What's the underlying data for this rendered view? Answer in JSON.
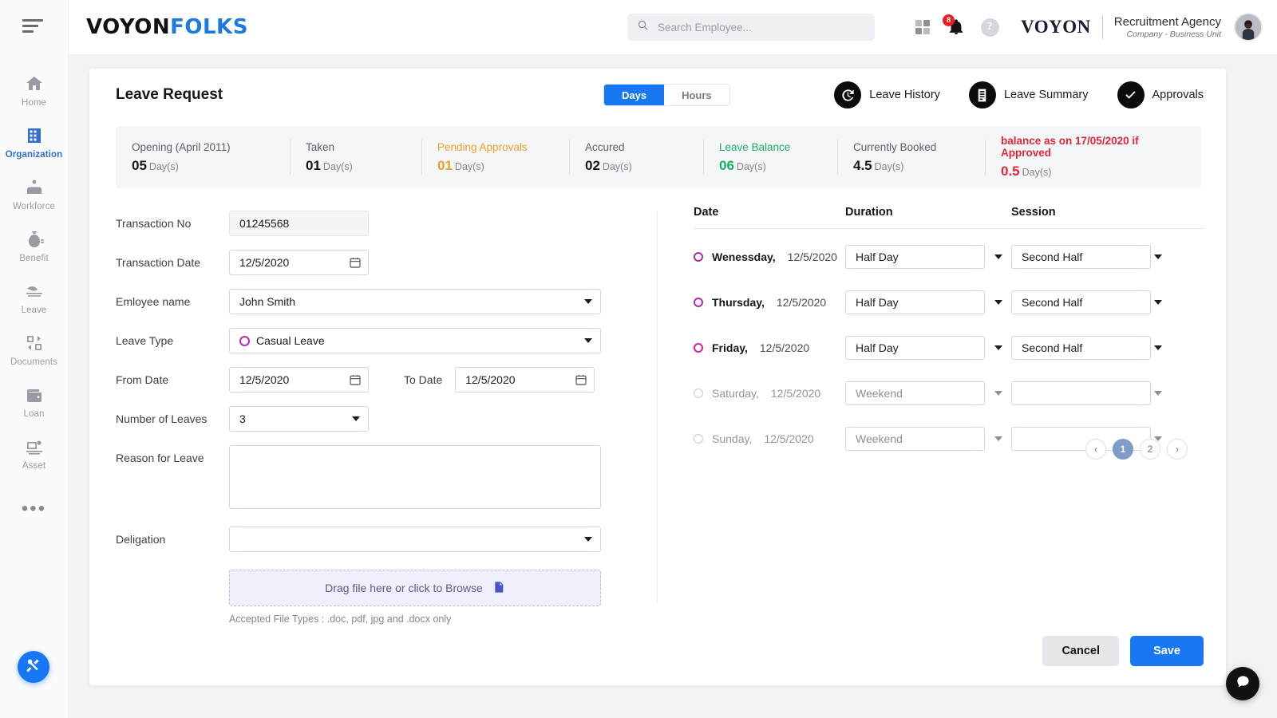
{
  "sidebar": {
    "menu_icon": "hamburger-icon",
    "items": [
      {
        "label": "Home",
        "icon": "home-icon",
        "active": false
      },
      {
        "label": "Organization",
        "icon": "building-icon",
        "active": true
      },
      {
        "label": "Workforce",
        "icon": "workforce-icon",
        "active": false
      },
      {
        "label": "Benefit",
        "icon": "money-bag-icon",
        "active": false
      },
      {
        "label": "Leave",
        "icon": "leave-icon",
        "active": false
      },
      {
        "label": "Documents",
        "icon": "documents-icon",
        "active": false
      },
      {
        "label": "Loan",
        "icon": "wallet-icon",
        "active": false
      },
      {
        "label": "Asset",
        "icon": "asset-icon",
        "active": false
      }
    ],
    "more_label": "•••",
    "fab_tools_icon": "tools-icon"
  },
  "header": {
    "logo_part1": "VOYON",
    "logo_part2": "FOLKS",
    "search_placeholder": "Search Employee...",
    "search_value": "",
    "notification_count": "8",
    "help_label": "?",
    "brand_mark": "VOYON",
    "company_name": "Recruitment Agency",
    "company_sub": "Company - Business Unit"
  },
  "page": {
    "title": "Leave Request",
    "toggle": {
      "active": "Days",
      "inactive": "Hours"
    },
    "actions": [
      {
        "label": "Leave History",
        "icon": "history-clock-icon"
      },
      {
        "label": "Leave Summary",
        "icon": "list-document-icon"
      },
      {
        "label": "Approvals",
        "icon": "check-icon"
      }
    ]
  },
  "stats": [
    {
      "label": "Opening (April 2011)",
      "value": "05",
      "unit": "Day(s)",
      "color": "#15151a",
      "label_color": "#5d5f68"
    },
    {
      "label": "Taken",
      "value": "01",
      "unit": "Day(s)",
      "color": "#15151a",
      "label_color": "#5d5f68"
    },
    {
      "label": "Pending Approvals",
      "value": "01",
      "unit": "Day(s)",
      "color": "#f0a02a",
      "label_color": "#f0a02a"
    },
    {
      "label": "Accured",
      "value": "02",
      "unit": "Day(s)",
      "color": "#15151a",
      "label_color": "#5d5f68"
    },
    {
      "label": "Leave Balance",
      "value": "06",
      "unit": "Day(s)",
      "color": "#18b05f",
      "label_color": "#18b05f"
    },
    {
      "label": "Currently Booked",
      "value": "4.5",
      "unit": "Day(s)",
      "color": "#15151a",
      "label_color": "#5d5f68"
    },
    {
      "label": "balance as on 17/05/2020 if Approved",
      "value": "0.5",
      "unit": "Day(s)",
      "color": "#e1263a",
      "label_color": "#e1263a"
    }
  ],
  "form": {
    "transaction_no": {
      "label": "Transaction No",
      "value": "01245568"
    },
    "transaction_date": {
      "label": "Transaction Date",
      "value": "12/5/2020"
    },
    "employee_name": {
      "label": "Emloyee name",
      "value": "John Smith"
    },
    "leave_type": {
      "label": "Leave Type",
      "value": "Casual Leave",
      "marker_color": "#c026b8"
    },
    "from_date": {
      "label": "From Date",
      "value": "12/5/2020"
    },
    "to_date": {
      "label": "To Date",
      "value": "12/5/2020"
    },
    "number_of_leaves": {
      "label": "Number of Leaves",
      "value": "3"
    },
    "reason": {
      "label": "Reason for Leave",
      "value": "",
      "placeholder": ""
    },
    "delegation": {
      "label": "Deligation",
      "value": ""
    },
    "upload": {
      "text": "Drag file here or click to Browse",
      "icon": "file-document-icon"
    },
    "accepted_types": "Accepted File Types : .doc, pdf, jpg and .docx only"
  },
  "table": {
    "columns": [
      "Date",
      "Duration",
      "Session"
    ],
    "rows": [
      {
        "day": "Wenessday,",
        "date": "12/5/2020",
        "duration": "Half Day",
        "session": "Second Half",
        "marker": "#b02ab0",
        "disabled": false
      },
      {
        "day": "Thursday,",
        "date": "12/5/2020",
        "duration": "Half Day",
        "session": "Second Half",
        "marker": "#b02ab0",
        "disabled": false
      },
      {
        "day": "Friday,",
        "date": "12/5/2020",
        "duration": "Half Day",
        "session": "Second Half",
        "marker": "#e0199e",
        "disabled": false
      },
      {
        "day": "Saturday,",
        "date": "12/5/2020",
        "duration": "Weekend",
        "session": "",
        "marker": "#c9cbd1",
        "disabled": true
      },
      {
        "day": "Sunday,",
        "date": "12/5/2020",
        "duration": "Weekend",
        "session": "",
        "marker": "#c9cbd1",
        "disabled": true
      }
    ],
    "pagination": {
      "prev": "‹",
      "pages": [
        "1",
        "2"
      ],
      "active_page": "1",
      "next": "›"
    }
  },
  "footer": {
    "cancel_label": "Cancel",
    "save_label": "Save"
  },
  "chat": {
    "icon": "chat-bubble-icon"
  },
  "colors": {
    "primary_blue": "#1877f2",
    "sidebar_active": "#2f6fd0",
    "warning": "#f0a02a",
    "success": "#18b05f",
    "danger": "#e1263a",
    "magenta": "#c026b8"
  }
}
